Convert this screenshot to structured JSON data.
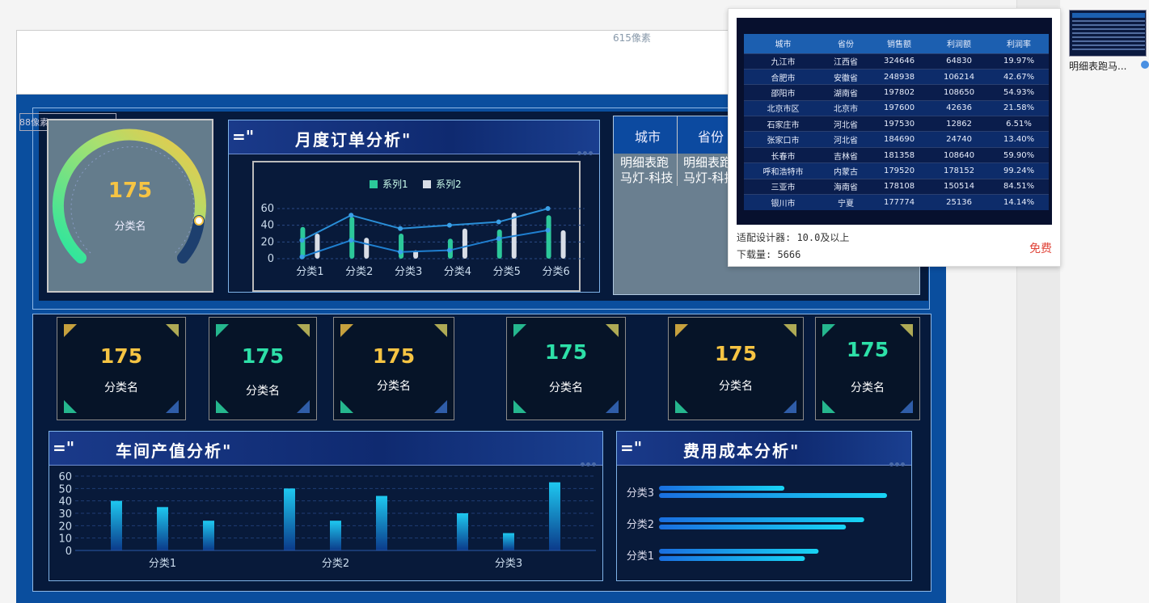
{
  "ruler": {
    "width_label": "615像素",
    "height_label": "88像素"
  },
  "gauge": {
    "value": "175",
    "label": "分类名",
    "accent": "#f6c443"
  },
  "monthly_orders": {
    "prefix": "=\"",
    "title": "月度订单分析\"",
    "chart_data": {
      "type": "bar",
      "categories": [
        "分类1",
        "分类2",
        "分类3",
        "分类4",
        "分类5",
        "分类6"
      ],
      "series": [
        {
          "name": "系列1",
          "values": [
            38,
            50,
            30,
            24,
            35,
            52
          ]
        },
        {
          "name": "系列2",
          "values": [
            30,
            25,
            10,
            36,
            55,
            34
          ]
        }
      ],
      "lines": [
        {
          "values": [
            22,
            52,
            36,
            40,
            44,
            60
          ]
        },
        {
          "values": [
            2,
            22,
            8,
            10,
            24,
            34
          ]
        }
      ],
      "ylim": [
        0,
        60
      ],
      "yticks": [
        "60",
        "40",
        "20",
        "0"
      ]
    }
  },
  "detail_table": {
    "headers": [
      "城市",
      "省份"
    ],
    "cells": [
      "明细表跑马灯-科技",
      "明细表跑马灯-科技"
    ]
  },
  "popup": {
    "columns": [
      "城市",
      "省份",
      "销售额",
      "利润额",
      "利润率"
    ],
    "rows": [
      [
        "九江市",
        "江西省",
        "324646",
        "64830",
        "19.97%"
      ],
      [
        "合肥市",
        "安徽省",
        "248938",
        "106214",
        "42.67%"
      ],
      [
        "邵阳市",
        "湖南省",
        "197802",
        "108650",
        "54.93%"
      ],
      [
        "北京市区",
        "北京市",
        "197600",
        "42636",
        "21.58%"
      ],
      [
        "石家庄市",
        "河北省",
        "197530",
        "12862",
        "6.51%"
      ],
      [
        "张家口市",
        "河北省",
        "184690",
        "24740",
        "13.40%"
      ],
      [
        "长春市",
        "吉林省",
        "181358",
        "108640",
        "59.90%"
      ],
      [
        "呼和浩特市",
        "内蒙古",
        "179520",
        "178152",
        "99.24%"
      ],
      [
        "三亚市",
        "海南省",
        "178108",
        "150514",
        "84.51%"
      ],
      [
        "银川市",
        "宁夏",
        "177774",
        "25136",
        "14.14%"
      ]
    ],
    "designer": "适配设计器: 10.0及以上",
    "downloads": "下载量: 5666",
    "price": "免费"
  },
  "cards": [
    {
      "value": "175",
      "label": "分类名",
      "color": "#f6c443"
    },
    {
      "value": "175",
      "label": "分类名",
      "color": "#2de0a8"
    },
    {
      "value": "175",
      "label": "分类名",
      "color": "#f6c443"
    },
    {
      "value": "175",
      "label": "分类名",
      "color": "#2de0a8"
    },
    {
      "value": "175",
      "label": "分类名",
      "color": "#f6c443"
    },
    {
      "value": "175",
      "label": "分类名",
      "color": "#2de0a8"
    }
  ],
  "workshop": {
    "prefix": "=\"",
    "title": "车间产值分析\"",
    "chart_data": {
      "type": "bar",
      "categories": [
        "分类1",
        "分类2",
        "分类3"
      ],
      "values": [
        40,
        35,
        24,
        50,
        24,
        44,
        30,
        14,
        55
      ],
      "ylim": [
        0,
        60
      ],
      "yticks": [
        "60",
        "50",
        "40",
        "30",
        "20",
        "10",
        "0"
      ]
    }
  },
  "cost": {
    "prefix": "=\"",
    "title": "费用成本分析\"",
    "chart_data": {
      "type": "bar",
      "categories": [
        "分类3",
        "分类2",
        "分类1"
      ],
      "series": [
        {
          "values": [
            55,
            90,
            70
          ]
        },
        {
          "values": [
            100,
            82,
            64
          ]
        }
      ]
    }
  },
  "thumbnail": {
    "label": "明细表跑马..."
  }
}
